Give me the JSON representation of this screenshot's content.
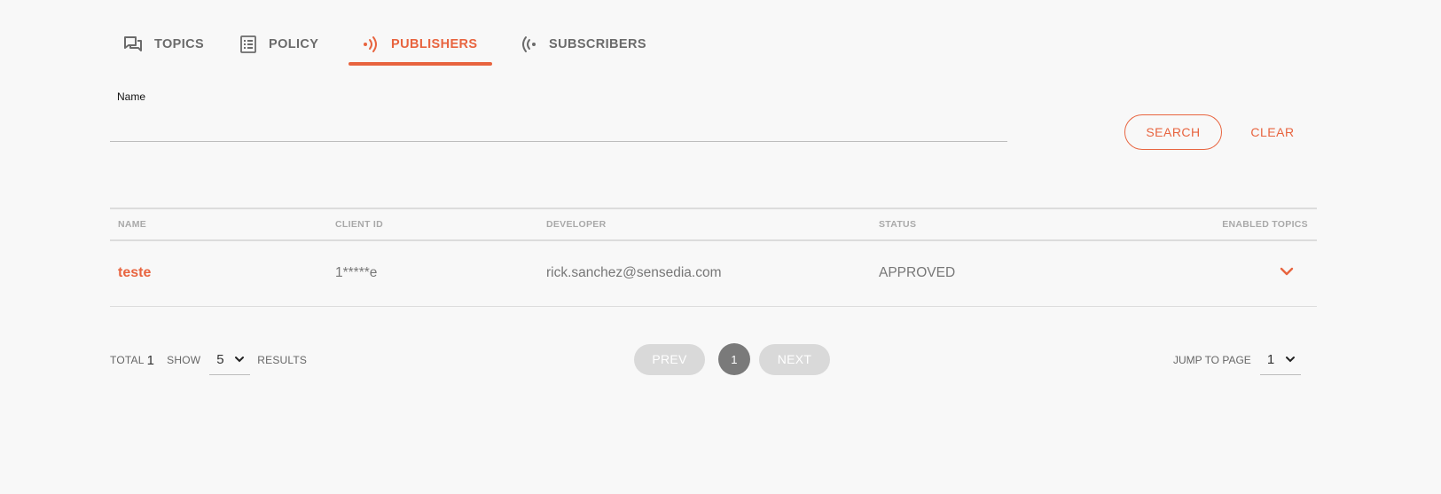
{
  "tabs": [
    {
      "label": "TOPICS",
      "icon": "forum-icon"
    },
    {
      "label": "POLICY",
      "icon": "list-document-icon"
    },
    {
      "label": "PUBLISHERS",
      "icon": "broadcast-icon",
      "active": true
    },
    {
      "label": "SUBSCRIBERS",
      "icon": "signal-receive-icon"
    }
  ],
  "search": {
    "label": "Name",
    "value": "",
    "search_button": "SEARCH",
    "clear_button": "CLEAR"
  },
  "table": {
    "columns": [
      "NAME",
      "CLIENT ID",
      "DEVELOPER",
      "STATUS",
      "ENABLED TOPICS"
    ],
    "rows": [
      {
        "name": "teste",
        "client_id": "1*****e",
        "developer": "rick.sanchez@sensedia.com",
        "status": "APPROVED"
      }
    ]
  },
  "footer": {
    "total_label": "TOTAL",
    "total_value": "1",
    "show_label": "SHOW",
    "show_value": "5",
    "results_label": "RESULTS",
    "prev": "PREV",
    "current_page": "1",
    "next": "NEXT",
    "jump_label": "JUMP TO PAGE",
    "jump_value": "1"
  },
  "colors": {
    "accent": "#e8643f",
    "tab_inactive": "#6b6b6b",
    "pager_disabled": "#d9d9d9",
    "pager_current": "#7a7a7a",
    "background": "#f8f8f8"
  }
}
